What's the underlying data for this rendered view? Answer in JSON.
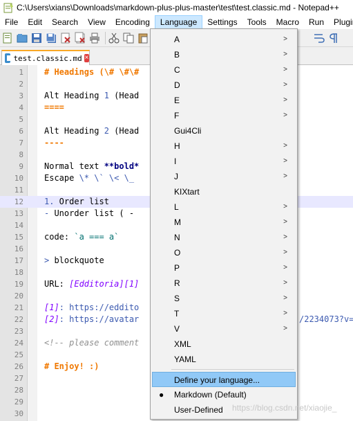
{
  "window": {
    "title": "C:\\Users\\xians\\Downloads\\markdown-plus-plus-master\\test\\test.classic.md - Notepad++"
  },
  "menubar": {
    "items": [
      "File",
      "Edit",
      "Search",
      "View",
      "Encoding",
      "Language",
      "Settings",
      "Tools",
      "Macro",
      "Run",
      "Plugins"
    ]
  },
  "tab": {
    "label": "test.classic.md",
    "close": "×"
  },
  "editor": {
    "current_line": 12,
    "line_numbers": [
      "1",
      "2",
      "3",
      "4",
      "5",
      "6",
      "7",
      "8",
      "9",
      "10",
      "11",
      "12",
      "13",
      "14",
      "15",
      "16",
      "17",
      "18",
      "19",
      "20",
      "21",
      "22",
      "23",
      "24",
      "25",
      "26",
      "27",
      "28",
      "29",
      "30"
    ],
    "lines": {
      "l1": "# Headings (\\# \\#\\#",
      "l3a": "Alt Heading ",
      "l3b": "1",
      "l3c": " (Head",
      "l4": "====",
      "l6a": "Alt Heading ",
      "l6b": "2",
      "l6c": " (Head",
      "l7": "----",
      "l9a": "Normal text ",
      "l9b": "**bold*",
      "l10a": "Escape ",
      "l10b": "\\* \\` \\< \\_",
      "l12a": "1.",
      "l12b": " Order list",
      "l13a": "-",
      "l13b": " Unorder list ( -",
      "l15a": "code: ",
      "l15b": "`a === a`",
      "l17a": ">",
      "l17b": " blockquote",
      "l19a": "URL: ",
      "l19b": "[Edditoria][1]",
      "l21a": "[1]",
      "l21b": ": https://eddito",
      "l22a": "[2]",
      "l22b": ": https://avatar",
      "l22c": "/2234073?v=",
      "l24": "<!-- please comment",
      "l26": "# Enjoy! :)"
    }
  },
  "language_menu": {
    "items": [
      {
        "label": "A",
        "submenu": true
      },
      {
        "label": "B",
        "submenu": true
      },
      {
        "label": "C",
        "submenu": true
      },
      {
        "label": "D",
        "submenu": true
      },
      {
        "label": "E",
        "submenu": true
      },
      {
        "label": "F",
        "submenu": true
      },
      {
        "label": "Gui4Cli",
        "submenu": false
      },
      {
        "label": "H",
        "submenu": true
      },
      {
        "label": "I",
        "submenu": true
      },
      {
        "label": "J",
        "submenu": true
      },
      {
        "label": "KIXtart",
        "submenu": false
      },
      {
        "label": "L",
        "submenu": true
      },
      {
        "label": "M",
        "submenu": true
      },
      {
        "label": "N",
        "submenu": true
      },
      {
        "label": "O",
        "submenu": true
      },
      {
        "label": "P",
        "submenu": true
      },
      {
        "label": "R",
        "submenu": true
      },
      {
        "label": "S",
        "submenu": true
      },
      {
        "label": "T",
        "submenu": true
      },
      {
        "label": "V",
        "submenu": true
      },
      {
        "label": "XML",
        "submenu": false
      },
      {
        "label": "YAML",
        "submenu": false
      }
    ],
    "define_language": "Define your language...",
    "markdown_default": "Markdown (Default)",
    "markdown_bullet": "●",
    "user_defined": "User-Defined",
    "submenu_arrow": ">"
  },
  "watermark": "https://blog.csdn.net/xiaojie_",
  "icons": [
    "notepad-app-icon",
    "new-file-icon",
    "open-file-icon",
    "save-icon",
    "save-all-icon",
    "close-icon",
    "close-all-icon",
    "print-icon",
    "cut-icon",
    "copy-icon",
    "paste-icon",
    "wrap-icon",
    "show-all-chars-icon"
  ],
  "colors": {
    "menu_highlight": "#91c9f7",
    "active_menu": "#cce8ff",
    "current_line": "#e8e8ff",
    "heading": "#f07800",
    "link": "#8000ff"
  }
}
